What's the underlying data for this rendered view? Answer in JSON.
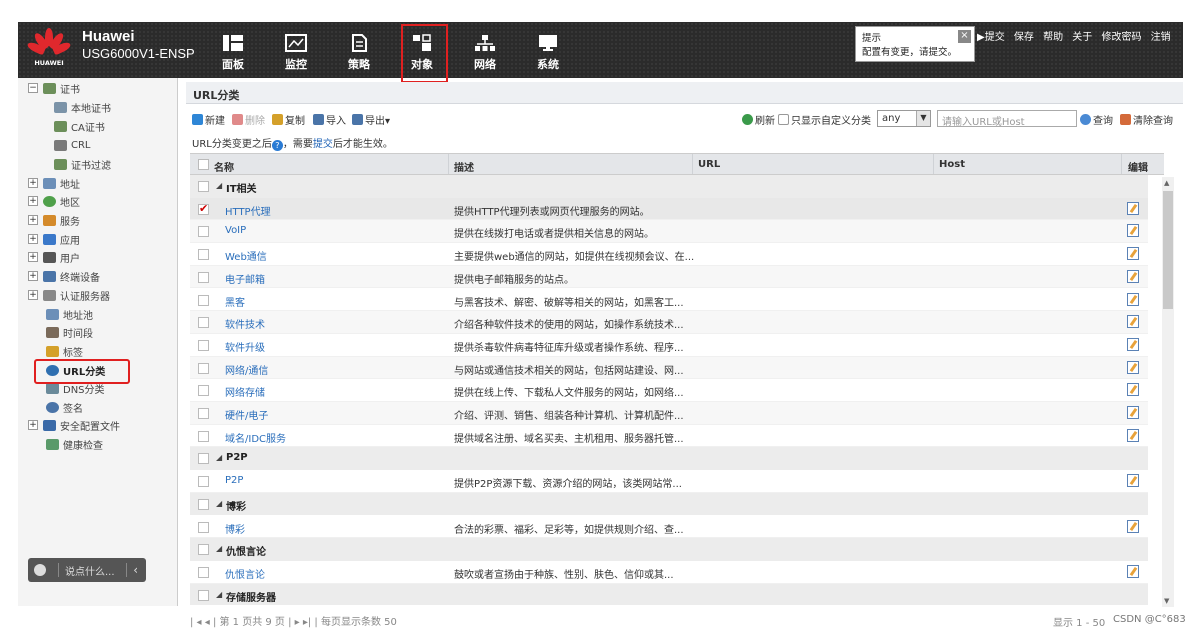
{
  "brand": {
    "logo_word": "HUAWEI",
    "name": "Huawei",
    "model": "USG6000V1-ENSP"
  },
  "nav": [
    {
      "label": "面板"
    },
    {
      "label": "监控"
    },
    {
      "label": "策略"
    },
    {
      "label": "对象"
    },
    {
      "label": "网络"
    },
    {
      "label": "系统"
    }
  ],
  "hint": {
    "title": "提示",
    "message": "配置有变更，请提交。",
    "close": "×"
  },
  "top_links": {
    "submit": "▶提交",
    "save": "保存",
    "help": "帮助",
    "about": "关于",
    "change_pwd": "修改密码",
    "logout": "注销"
  },
  "tree": [
    {
      "label": "证书",
      "pm": "−"
    },
    {
      "label": "本地证书"
    },
    {
      "label": "CA证书"
    },
    {
      "label": "CRL"
    },
    {
      "label": "证书过滤"
    },
    {
      "label": "地址",
      "pm": "+"
    },
    {
      "label": "地区",
      "pm": "+"
    },
    {
      "label": "服务",
      "pm": "+"
    },
    {
      "label": "应用",
      "pm": "+"
    },
    {
      "label": "用户",
      "pm": "+"
    },
    {
      "label": "终端设备",
      "pm": "+"
    },
    {
      "label": "认证服务器",
      "pm": "+"
    },
    {
      "label": "地址池"
    },
    {
      "label": "时间段"
    },
    {
      "label": "标签"
    },
    {
      "label": "URL分类"
    },
    {
      "label": "DNS分类"
    },
    {
      "label": "签名"
    },
    {
      "label": "安全配置文件",
      "pm": "+"
    },
    {
      "label": "健康检查"
    }
  ],
  "chat": {
    "placeholder": "说点什么...",
    "arrow": "‹"
  },
  "panel": {
    "title": "URL分类"
  },
  "toolbar": {
    "new": "新建",
    "delete": "删除",
    "copy": "复制",
    "import": "导入",
    "export": "导出▾",
    "refresh": "刷新",
    "custom_only": "只显示自定义分类",
    "filter_value": "any",
    "search_placeholder": "请输入URL或Host",
    "query": "查询",
    "clear": "清除查询"
  },
  "notice": {
    "before": "URL分类变更之后",
    "q": "?",
    "mid": "，需要",
    "link": "提交",
    "after": "后才能生效。"
  },
  "columns": {
    "name": "名称",
    "desc": "描述",
    "url": "URL",
    "host": "Host",
    "edit": "编辑"
  },
  "rows": [
    {
      "type": "group",
      "name": "IT相关"
    },
    {
      "type": "item",
      "name": "HTTP代理",
      "desc": "提供HTTP代理列表或网页代理服务的网站。",
      "checked": true
    },
    {
      "type": "item",
      "name": "VoIP",
      "desc": "提供在线拨打电话或者提供相关信息的网站。"
    },
    {
      "type": "item",
      "name": "Web通信",
      "desc": "主要提供web通信的网站，如提供在线视频会议、在..."
    },
    {
      "type": "item",
      "name": "电子邮箱",
      "desc": "提供电子邮箱服务的站点。"
    },
    {
      "type": "item",
      "name": "黑客",
      "desc": "与黑客技术、解密、破解等相关的网站，如黑客工..."
    },
    {
      "type": "item",
      "name": "软件技术",
      "desc": "介绍各种软件技术的使用的网站，如操作系统技术..."
    },
    {
      "type": "item",
      "name": "软件升级",
      "desc": "提供杀毒软件病毒特征库升级或者操作系统、程序..."
    },
    {
      "type": "item",
      "name": "网络/通信",
      "desc": "与网站或通信技术相关的网站，包括网站建设、网..."
    },
    {
      "type": "item",
      "name": "网络存储",
      "desc": "提供在线上传、下载私人文件服务的网站，如网络..."
    },
    {
      "type": "item",
      "name": "硬件/电子",
      "desc": "介绍、评测、销售、组装各种计算机、计算机配件..."
    },
    {
      "type": "item",
      "name": "域名/IDC服务",
      "desc": "提供域名注册、域名买卖、主机租用、服务器托管..."
    },
    {
      "type": "group",
      "name": "P2P"
    },
    {
      "type": "item",
      "name": "P2P",
      "desc": "提供P2P资源下载、资源介绍的网站，该类网站常..."
    },
    {
      "type": "group",
      "name": "博彩"
    },
    {
      "type": "item",
      "name": "博彩",
      "desc": "合法的彩票、福彩、足彩等，如提供规则介绍、查..."
    },
    {
      "type": "group",
      "name": "仇恨言论"
    },
    {
      "type": "item",
      "name": "仇恨言论",
      "desc": "鼓吹或者宣扬由于种族、性别、肤色、信仰或其..."
    },
    {
      "type": "group",
      "name": "存储服务器"
    }
  ],
  "pager": {
    "text": "| ◂ ◂ | 第 1   页共 9 页 | ▸ ▸| | 每页显示条数 50"
  },
  "footer": {
    "right": "显示 1 - 50",
    "watermark": "CSDN @C°683"
  },
  "colors": {
    "accent_red": "#e02020",
    "link_blue": "#2a6ebb",
    "banner_dark": "#2b2b2b"
  }
}
